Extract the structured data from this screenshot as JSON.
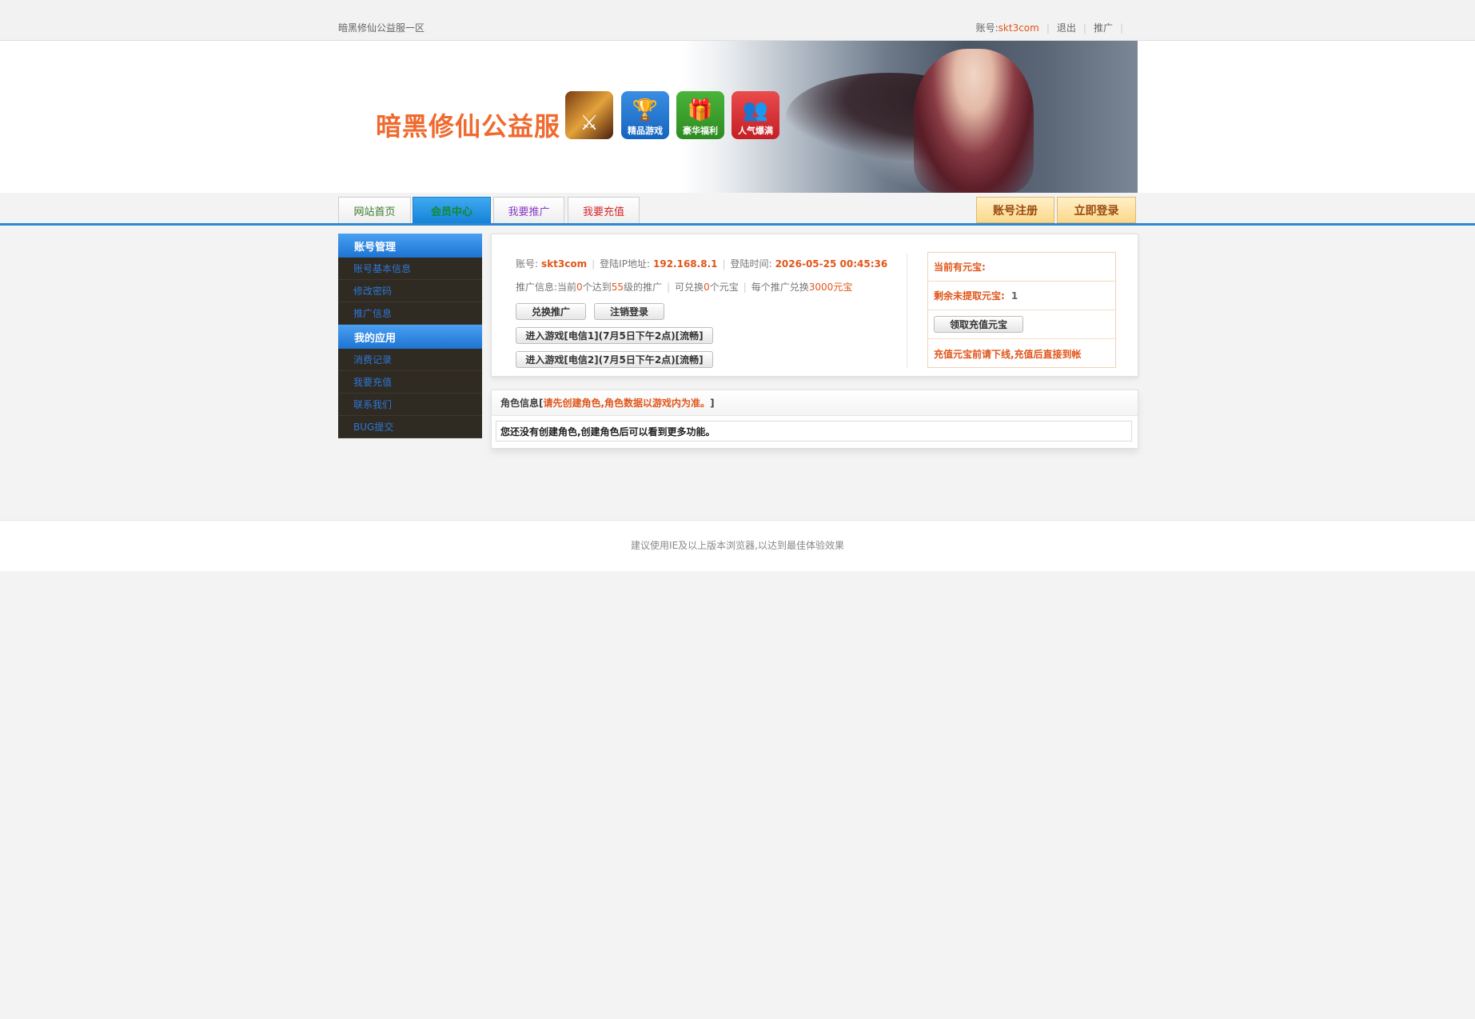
{
  "topbar": {
    "site_name": "暗黑修仙公益服一区",
    "account_label": "账号:",
    "account_value": "skt3com",
    "logout": "退出",
    "promote": "推广"
  },
  "banner": {
    "title": "暗黑修仙公益服",
    "icons": [
      {
        "icon": "game-art-icon",
        "label": ""
      },
      {
        "icon": "trophy-icon",
        "label": "精品游戏"
      },
      {
        "icon": "gift-icon",
        "label": "豪华福利"
      },
      {
        "icon": "people-icon",
        "label": "人气爆满"
      }
    ]
  },
  "nav": {
    "tabs": [
      "网站首页",
      "会员中心",
      "我要推广",
      "我要充值"
    ],
    "register": "账号注册",
    "login": "立即登录"
  },
  "sidebar": {
    "sections": [
      {
        "title": "账号管理",
        "items": [
          "账号基本信息",
          "修改密码",
          "推广信息"
        ]
      },
      {
        "title": "我的应用",
        "items": [
          "消费记录",
          "我要充值",
          "联系我们",
          "BUG提交"
        ]
      }
    ]
  },
  "account_info": {
    "account_label": "账号:",
    "account_value": "skt3com",
    "ip_label": "登陆IP地址:",
    "ip_value": "192.168.8.1",
    "time_label": "登陆时间:",
    "time_value": "2026-05-25 00:45:36",
    "promo_prefix": "推广信息:当前",
    "promo_count": "0",
    "promo_mid1": "个达到",
    "promo_level": "55",
    "promo_mid2": "级的推广",
    "redeem_prefix": "可兑换",
    "redeem_count": "0",
    "redeem_suffix": "个元宝",
    "per_promo_prefix": "每个推广兑换",
    "per_promo_value": "3000元宝",
    "btn_redeem": "兑换推广",
    "btn_logout": "注销登录",
    "btn_game1": "进入游戏[电信1](7月5日下午2点)[流畅]",
    "btn_game2": "进入游戏[电信2](7月5日下午2点)[流畅]"
  },
  "yuanbao": {
    "current_label": "当前有元宝:",
    "remaining_label": "剩余未提取元宝:",
    "remaining_value": "1",
    "claim_button": "领取充值元宝",
    "notice": "充值元宝前请下线,充值后直接到帐"
  },
  "role": {
    "head_prefix": "角色信息[",
    "head_warn": "请先创建角色,角色数据以游戏内为准。",
    "head_suffix": "]",
    "body": "您还没有创建角色,创建角色后可以看到更多功能。"
  },
  "footer": {
    "text": "建议使用IE及以上版本浏览器,以达到最佳体验效果"
  },
  "colors": {
    "accent_blue": "#2d87d2",
    "highlight_orange": "#e0561b"
  }
}
